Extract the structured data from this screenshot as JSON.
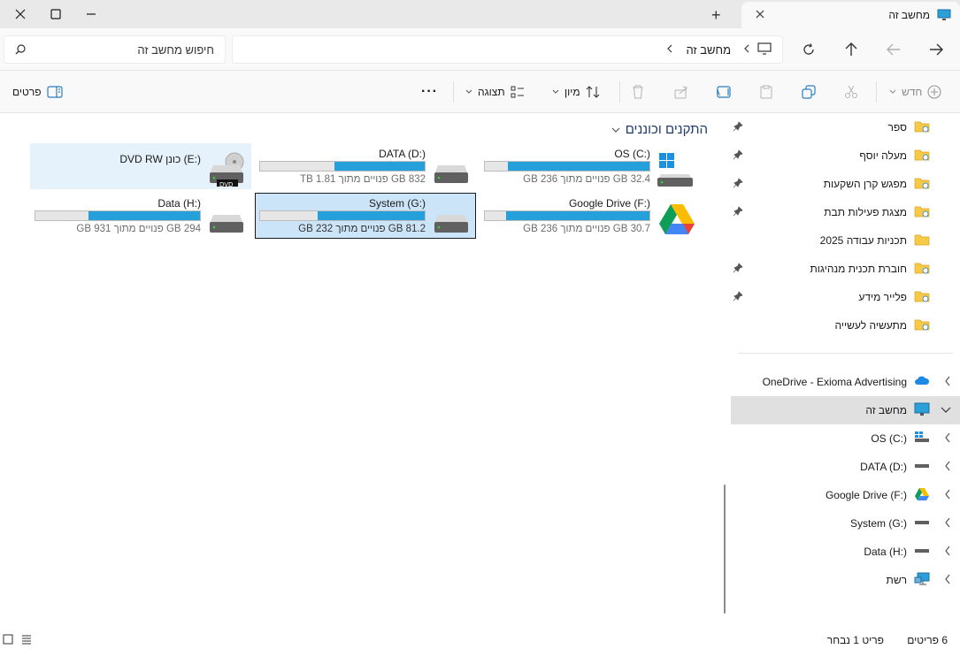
{
  "window": {
    "tab_title": "מחשב זה",
    "new_tab_label": "+"
  },
  "address": {
    "segments": [
      "מחשב זה"
    ],
    "search_placeholder": "חיפוש מחשב זה"
  },
  "toolbar": {
    "new_label": "חדש",
    "sort_label": "מיון",
    "view_label": "תצוגה",
    "more_label": "···",
    "details_label": "פרטים"
  },
  "content": {
    "group_title": "התקנים וכוננים",
    "drives": [
      {
        "name": "OS (C:)",
        "free_text": "32.4 GB פנויים מתוך 236 GB",
        "used_fraction": 0.86,
        "icon": "windows-drive-icon"
      },
      {
        "name": "DATA (D:)",
        "free_text": "832 GB פנויים מתוך 1.81 TB",
        "used_fraction": 0.55,
        "icon": "hard-drive-icon"
      },
      {
        "name": "DVD RW כונן (E:)",
        "free_text": "",
        "used_fraction": null,
        "icon": "dvd-drive-icon"
      },
      {
        "name": "Google Drive (F:)",
        "free_text": "30.7 GB פנויים מתוך 236 GB",
        "used_fraction": 0.87,
        "icon": "google-drive-icon"
      },
      {
        "name": "System (G:)",
        "free_text": "81.2 GB פנויים מתוך 232 GB",
        "used_fraction": 0.65,
        "icon": "hard-drive-icon"
      },
      {
        "name": "Data (H:)",
        "free_text": "294 GB פנויים מתוך 931 GB",
        "used_fraction": 0.68,
        "icon": "hard-drive-icon"
      }
    ]
  },
  "nav": {
    "pinned": [
      {
        "label": "ספר"
      },
      {
        "label": "מעלה יוסף"
      },
      {
        "label": "מפגש קרן השקעות"
      },
      {
        "label": "מצגת פעילות תבת"
      },
      {
        "label": "תכניות עבודה 2025"
      },
      {
        "label": "חוברת תכנית מנהיגות"
      },
      {
        "label": "פלייר מידע"
      },
      {
        "label": "מתעשיה לעשייה"
      }
    ],
    "onedrive": "OneDrive - Exioma Advertising",
    "this_pc": "מחשב זה",
    "drives": [
      {
        "label": "OS (C:)"
      },
      {
        "label": "DATA (D:)"
      },
      {
        "label": "Google Drive (F:)"
      },
      {
        "label": "System (G:)"
      },
      {
        "label": "Data (H:)"
      }
    ],
    "network": "רשת"
  },
  "status": {
    "items_count": "6 פריטים",
    "selected": "פריט 1 נבחר"
  },
  "colors": {
    "accent": "#26a0da",
    "folder": "#f7c948",
    "selected_bg": "#cce4f7"
  }
}
